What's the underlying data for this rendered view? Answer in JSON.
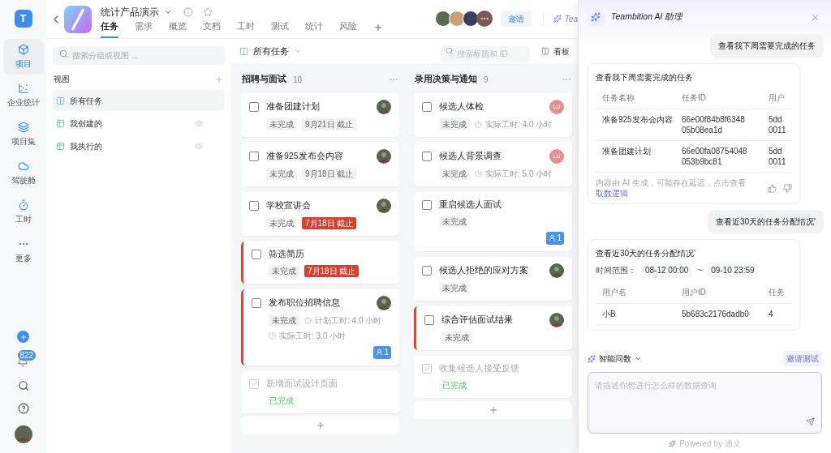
{
  "rail": {
    "logo": "T",
    "items": [
      {
        "label": "项目",
        "selected": true
      },
      {
        "label": "企业统计",
        "selected": false
      },
      {
        "label": "项目集",
        "selected": false
      },
      {
        "label": "驾驶舱",
        "selected": false
      },
      {
        "label": "工时",
        "selected": false
      },
      {
        "label": "更多",
        "selected": false
      }
    ],
    "notification_count": "822"
  },
  "header": {
    "title": "统计产品演示",
    "tabs": [
      {
        "label": "任务",
        "selected": true
      },
      {
        "label": "需求",
        "selected": false
      },
      {
        "label": "概览",
        "selected": false
      },
      {
        "label": "文档",
        "selected": false
      },
      {
        "label": "工时",
        "selected": false
      },
      {
        "label": "测试",
        "selected": false
      },
      {
        "label": "统计",
        "selected": false
      },
      {
        "label": "风险",
        "selected": false
      }
    ],
    "member_avatars": [
      {
        "color": "#5b6b52"
      },
      {
        "color": "#c9a27a"
      },
      {
        "color": "#3b3f5c"
      }
    ],
    "invite_button": "邀请",
    "ai_button": "Tea"
  },
  "views_panel": {
    "search_placeholder": "搜索分组或视图 ...",
    "section_title": "视图",
    "items": [
      {
        "label": "所有任务",
        "kind": "all",
        "selected": true
      },
      {
        "label": "我创建的",
        "kind": "table",
        "selected": false
      },
      {
        "label": "我执行的",
        "kind": "table",
        "selected": false
      }
    ]
  },
  "board": {
    "current_view": "所有任务",
    "search_placeholder": "搜索标题和 ID",
    "view_mode": "看板",
    "columns": [
      {
        "title": "招聘与面试",
        "count": "10",
        "cards": [
          {
            "title": "准备团建计划",
            "done": false,
            "flagged": false,
            "status": "未完成",
            "due": {
              "text": "9月21日 截止",
              "overdue": false
            },
            "assignee": {
              "kind": "photo"
            }
          },
          {
            "title": "准备925发布会内容",
            "done": false,
            "flagged": false,
            "status": "未完成",
            "due": {
              "text": "9月18日 截止",
              "overdue": false
            },
            "assignee": {
              "kind": "photo"
            }
          },
          {
            "title": "学校宣讲会",
            "done": false,
            "flagged": false,
            "status": "未完成",
            "due": {
              "text": "7月18日 截止",
              "overdue": true
            },
            "assignee": {
              "kind": "photo"
            }
          },
          {
            "title": "筛选简历",
            "done": false,
            "flagged": true,
            "status": "未完成",
            "due": {
              "text": "7月18日 截止",
              "overdue": true
            }
          },
          {
            "title": "发布职位招聘信息",
            "done": false,
            "flagged": true,
            "status": "未完成",
            "hours": [
              "计划工时: 4.0 小时",
              "实际工时: 3.0 小时"
            ],
            "assignee": {
              "kind": "photo"
            },
            "badge": "1"
          },
          {
            "title": "新增面试设计页面",
            "done": true,
            "flagged": false,
            "status": "已完成"
          }
        ]
      },
      {
        "title": "录用决策与通知",
        "count": "9",
        "cards": [
          {
            "title": "候选人体检",
            "done": false,
            "flagged": false,
            "status": "未完成",
            "hours": [
              "实际工时: 4.0 小时"
            ],
            "assignee": {
              "kind": "initials",
              "text": "LU"
            }
          },
          {
            "title": "候选人背景调查",
            "done": false,
            "flagged": false,
            "status": "未完成",
            "hours": [
              "实际工时: 5.0 小时"
            ],
            "assignee": {
              "kind": "initials",
              "text": "LU"
            }
          },
          {
            "title": "重启候选人面试",
            "done": false,
            "flagged": false,
            "status": "未完成",
            "badge": "1"
          },
          {
            "title": "候选人拒绝的应对方案",
            "done": false,
            "flagged": false,
            "status": "未完成",
            "assignee": {
              "kind": "photo"
            }
          },
          {
            "title": "综合评估面试结果",
            "done": false,
            "flagged": true,
            "status": "未完成",
            "assignee": {
              "kind": "photo"
            }
          },
          {
            "title": "收集候选人接受反馈",
            "done": true,
            "flagged": false,
            "status": "已完成"
          }
        ]
      }
    ]
  },
  "assistant": {
    "title": "Teambition AI 助理",
    "messages": [
      {
        "kind": "user",
        "text": "查看我下周需要完成的任务"
      },
      {
        "kind": "answer",
        "title": "查看我下周需要完成的任务",
        "columns": [
          "任务名称",
          "任务ID",
          "用户"
        ],
        "rows": [
          [
            [
              "准备925发布会内容"
            ],
            [
              "66e00f84b8f6348",
              "05b08ea1d"
            ],
            [
              "5dd",
              "0011"
            ]
          ],
          [
            [
              "准备团建计划"
            ],
            [
              "66e00fa08754048",
              "053b9bc81"
            ],
            [
              "5dd",
              "0011"
            ]
          ]
        ],
        "disclaimer": "内容由 AI 生成，可能存在延迟，点击查看",
        "logic_link": "取数逻辑"
      },
      {
        "kind": "user",
        "text": "查看近30天的任务分配情况'"
      },
      {
        "kind": "answer",
        "title": "查看近30天的任务分配情况'",
        "range": {
          "label": "时间范围：",
          "from": "08-12 00:00",
          "separator": "~",
          "to": "09-10 23:59"
        },
        "columns": [
          "用户名",
          "用户ID",
          "任务"
        ],
        "rows": [
          [
            [
              "小B"
            ],
            [
              "5b683c2176dadb0"
            ],
            [
              "4"
            ]
          ]
        ]
      }
    ],
    "mode": "智能问数",
    "invite_test": "邀请测试",
    "input_placeholder": "请描述你想进行怎么样的数据查询",
    "powered_by": "Powered by 通义"
  }
}
